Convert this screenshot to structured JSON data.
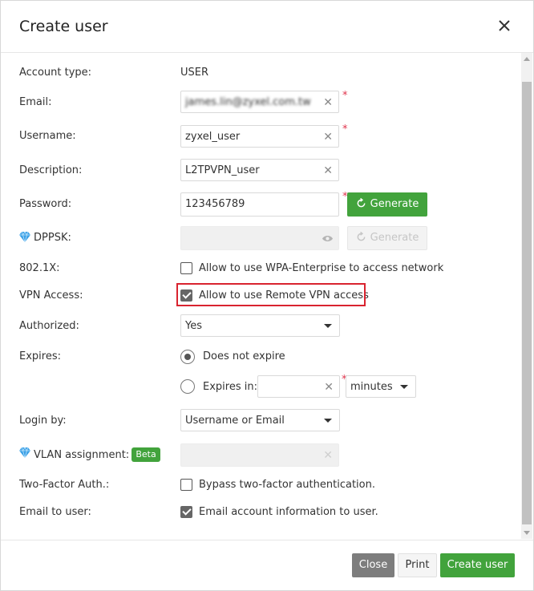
{
  "dialog": {
    "title": "Create user"
  },
  "form": {
    "account_type": {
      "label": "Account type:",
      "value": "USER"
    },
    "email": {
      "label": "Email:",
      "value": "james.lin@zyxel.com.tw"
    },
    "username": {
      "label": "Username:",
      "value": "zyxel_user"
    },
    "description": {
      "label": "Description:",
      "value": "L2TPVPN_user"
    },
    "password": {
      "label": "Password:",
      "value": "123456789",
      "generate_label": "Generate"
    },
    "dppsk": {
      "label": "DPPSK:",
      "value": "",
      "generate_label": "Generate"
    },
    "dot1x": {
      "label": "802.1X:",
      "checkbox_label": "Allow to use WPA-Enterprise to access network",
      "checked": false
    },
    "vpn_access": {
      "label": "VPN Access:",
      "checkbox_label": "Allow to use Remote VPN access",
      "checked": true
    },
    "authorized": {
      "label": "Authorized:",
      "value": "Yes"
    },
    "expires": {
      "label": "Expires:",
      "option_never": "Does not expire",
      "option_in": "Expires in:",
      "selected": "never",
      "amount": "",
      "unit": "minutes"
    },
    "login_by": {
      "label": "Login by:",
      "value": "Username or Email"
    },
    "vlan": {
      "label": "VLAN assignment:",
      "badge": "Beta",
      "value": ""
    },
    "two_factor": {
      "label": "Two-Factor Auth.:",
      "checkbox_label": "Bypass two-factor authentication.",
      "checked": false
    },
    "email_to_user": {
      "label": "Email to user:",
      "checkbox_label": "Email account information to user.",
      "checked": true
    }
  },
  "footer": {
    "close_label": "Close",
    "print_label": "Print",
    "create_label": "Create user"
  },
  "colors": {
    "accent_green": "#42a33c",
    "highlight_red": "#d9232f",
    "required": "#e0334c",
    "gem_blue": "#3aa0e6"
  }
}
